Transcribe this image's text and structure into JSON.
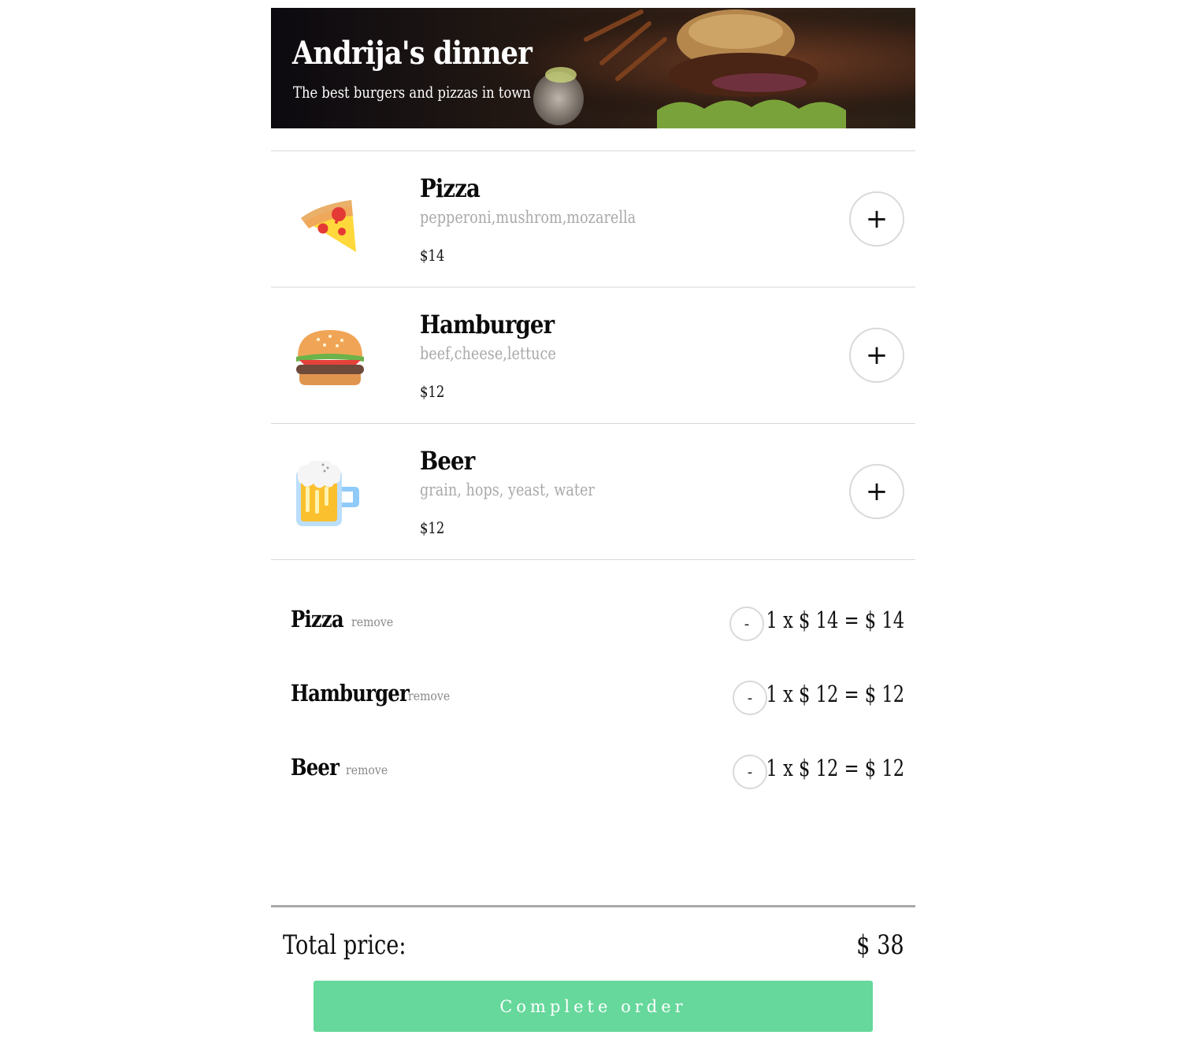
{
  "header": {
    "title": "Andrija's dinner",
    "subtitle": "The best burgers and pizzas in town"
  },
  "menu": {
    "items": [
      {
        "name": "Pizza",
        "description": "pepperoni,mushrom,mozarella",
        "price": "$14",
        "icon": "pizza-icon",
        "add_label": "+"
      },
      {
        "name": "Hamburger",
        "description": "beef,cheese,lettuce",
        "price": "$12",
        "icon": "hamburger-icon",
        "add_label": "+"
      },
      {
        "name": "Beer",
        "description": "grain, hops, yeast, water",
        "price": "$12",
        "icon": "beer-icon",
        "add_label": "+"
      }
    ]
  },
  "cart": {
    "remove_label": "remove",
    "minus_label": "-",
    "rows": [
      {
        "name": "Pizza",
        "calc": "1 x $ 14  = $ 14"
      },
      {
        "name": "Hamburger",
        "calc": "1 x $ 12  = $ 12"
      },
      {
        "name": "Beer",
        "calc": "1 x $ 12  = $ 12"
      }
    ]
  },
  "total": {
    "label": "Total price:",
    "value": "$ 38"
  },
  "actions": {
    "complete_label": "Complete order"
  },
  "colors": {
    "accent": "#66d89b",
    "muted_text": "#a9a9a9",
    "border": "#d9d9d9"
  }
}
